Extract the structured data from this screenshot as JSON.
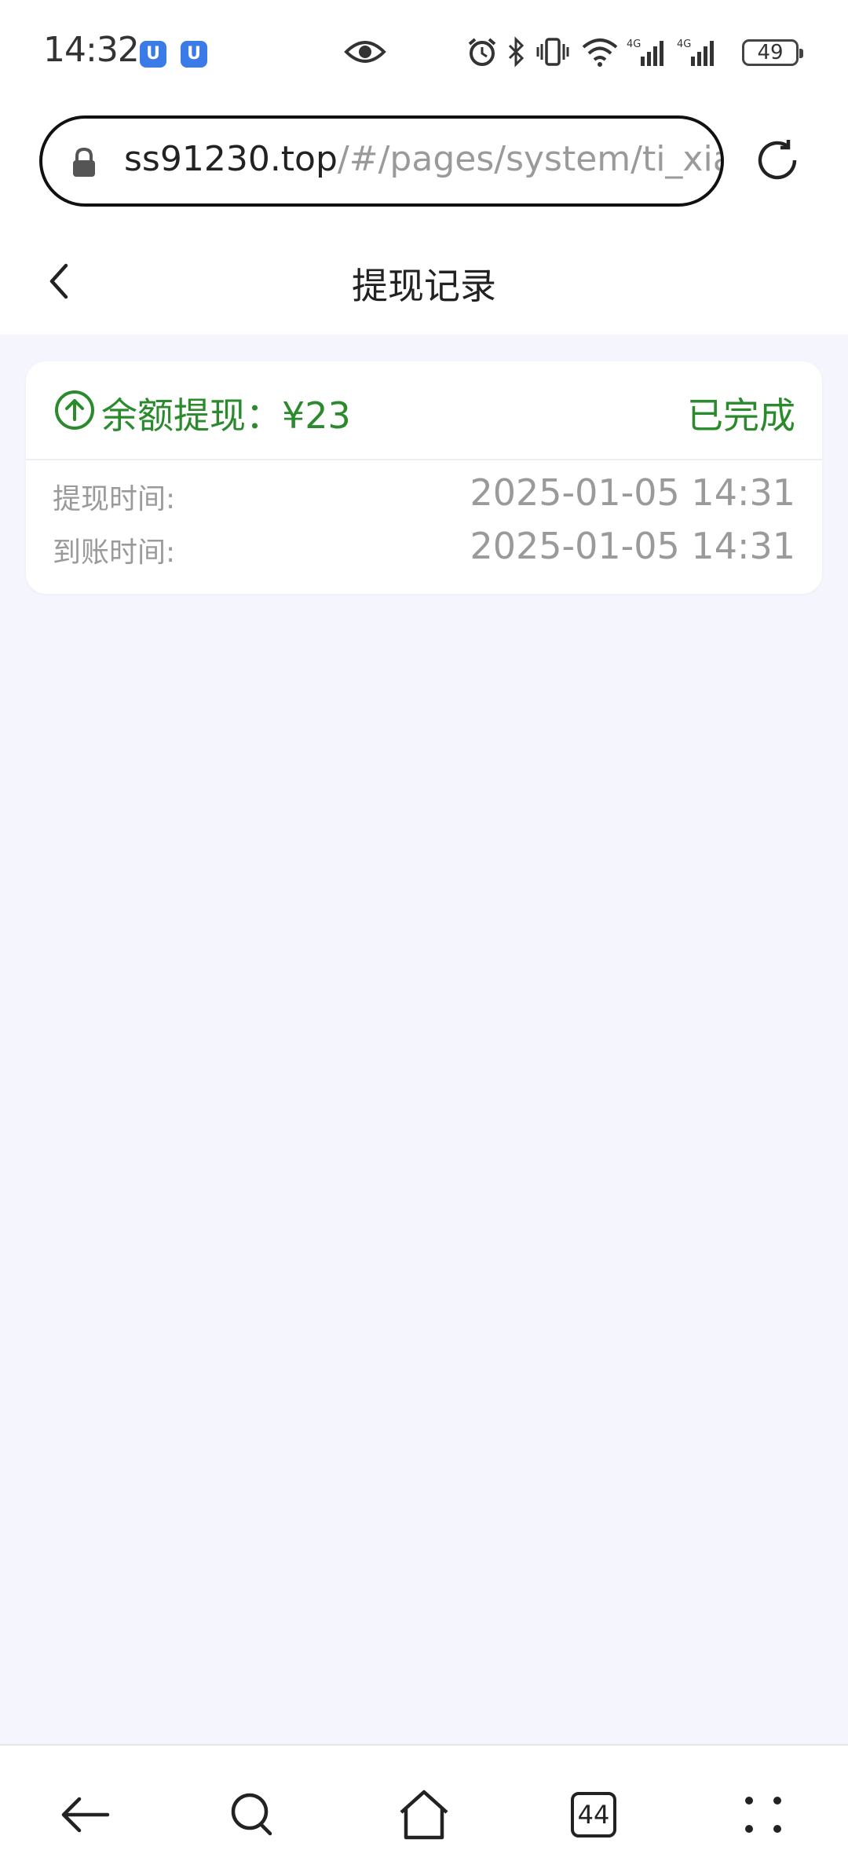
{
  "status_bar": {
    "time": "14:32",
    "app_icon_glyph": "U",
    "battery": "49",
    "icons": [
      "eye-icon",
      "alarm-icon",
      "bluetooth-icon",
      "vibrate-icon",
      "wifi-icon",
      "signal-4g-icon",
      "signal-4g-icon"
    ]
  },
  "browser": {
    "url_host": "ss91230.top",
    "url_path": "/#/pages/system/ti_xian",
    "tabs_count": "44"
  },
  "header": {
    "title": "提现记录"
  },
  "record": {
    "title": "余额提现：¥23",
    "status": "已完成",
    "withdraw_time_label": "提现时间:",
    "withdraw_time": "2025-01-05 14:31",
    "arrival_time_label": "到账时间:",
    "arrival_time": "2025-01-05 14:31"
  },
  "colors": {
    "accent_green": "#2a8a2c",
    "page_bg": "#f5f6fd",
    "muted_text": "#9a9a9a"
  }
}
